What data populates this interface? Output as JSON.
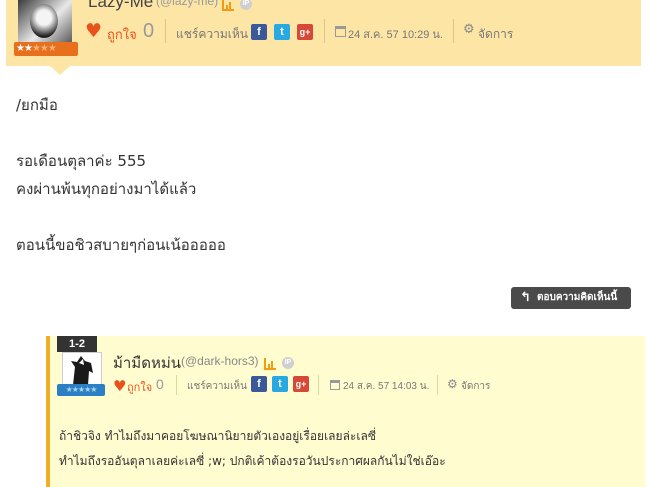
{
  "post": {
    "username": "Lazy-Me",
    "handle": "(@lazy-me)",
    "stars": "★★",
    "stars_off": "★★★",
    "like_label": "ถูกใจ",
    "like_count": "0",
    "share_label": "แชร์ความเห็น",
    "date": "24 ส.ค. 57 10:29 น.",
    "manage_label": "จัดการ",
    "lines": [
      "/ยกมือ",
      "รอเดือนตุลาค่ะ 555",
      "คงผ่านพ้นทุกอย่างมาได้แล้ว",
      "ตอนนี้ขอชิวสบายๆก่อนเน้อออออ"
    ],
    "reply_button": "ตอบความคิดเห็นนี้"
  },
  "reply": {
    "number": "1-2",
    "username": "ม้ามืดหม่น",
    "handle": "(@dark-hors3)",
    "stars": "★★★★★",
    "like_label": "ถูกใจ",
    "like_count": "0",
    "share_label": "แชร์ความเห็น",
    "date": "24 ส.ค. 57 14:03 น.",
    "manage_label": "จัดการ",
    "lines": [
      "ถ้าชิวจิง ทำไมถึงมาคอยโฆษณานิยายตัวเองอยู่เรื่อยเลยล่ะเลซี่",
      "ทำไมถึงรออันตุลาเลยค่ะเลซี่ ;w; ปกติเค้าต้องรอวันประกาศผลกันไม่ใช่เอ๊อะ"
    ]
  },
  "colors": {
    "header_bg": "#fde5a6",
    "reply_bg": "#fffdd0",
    "accent": "#e8531c",
    "reply_border": "#f0ad28"
  }
}
